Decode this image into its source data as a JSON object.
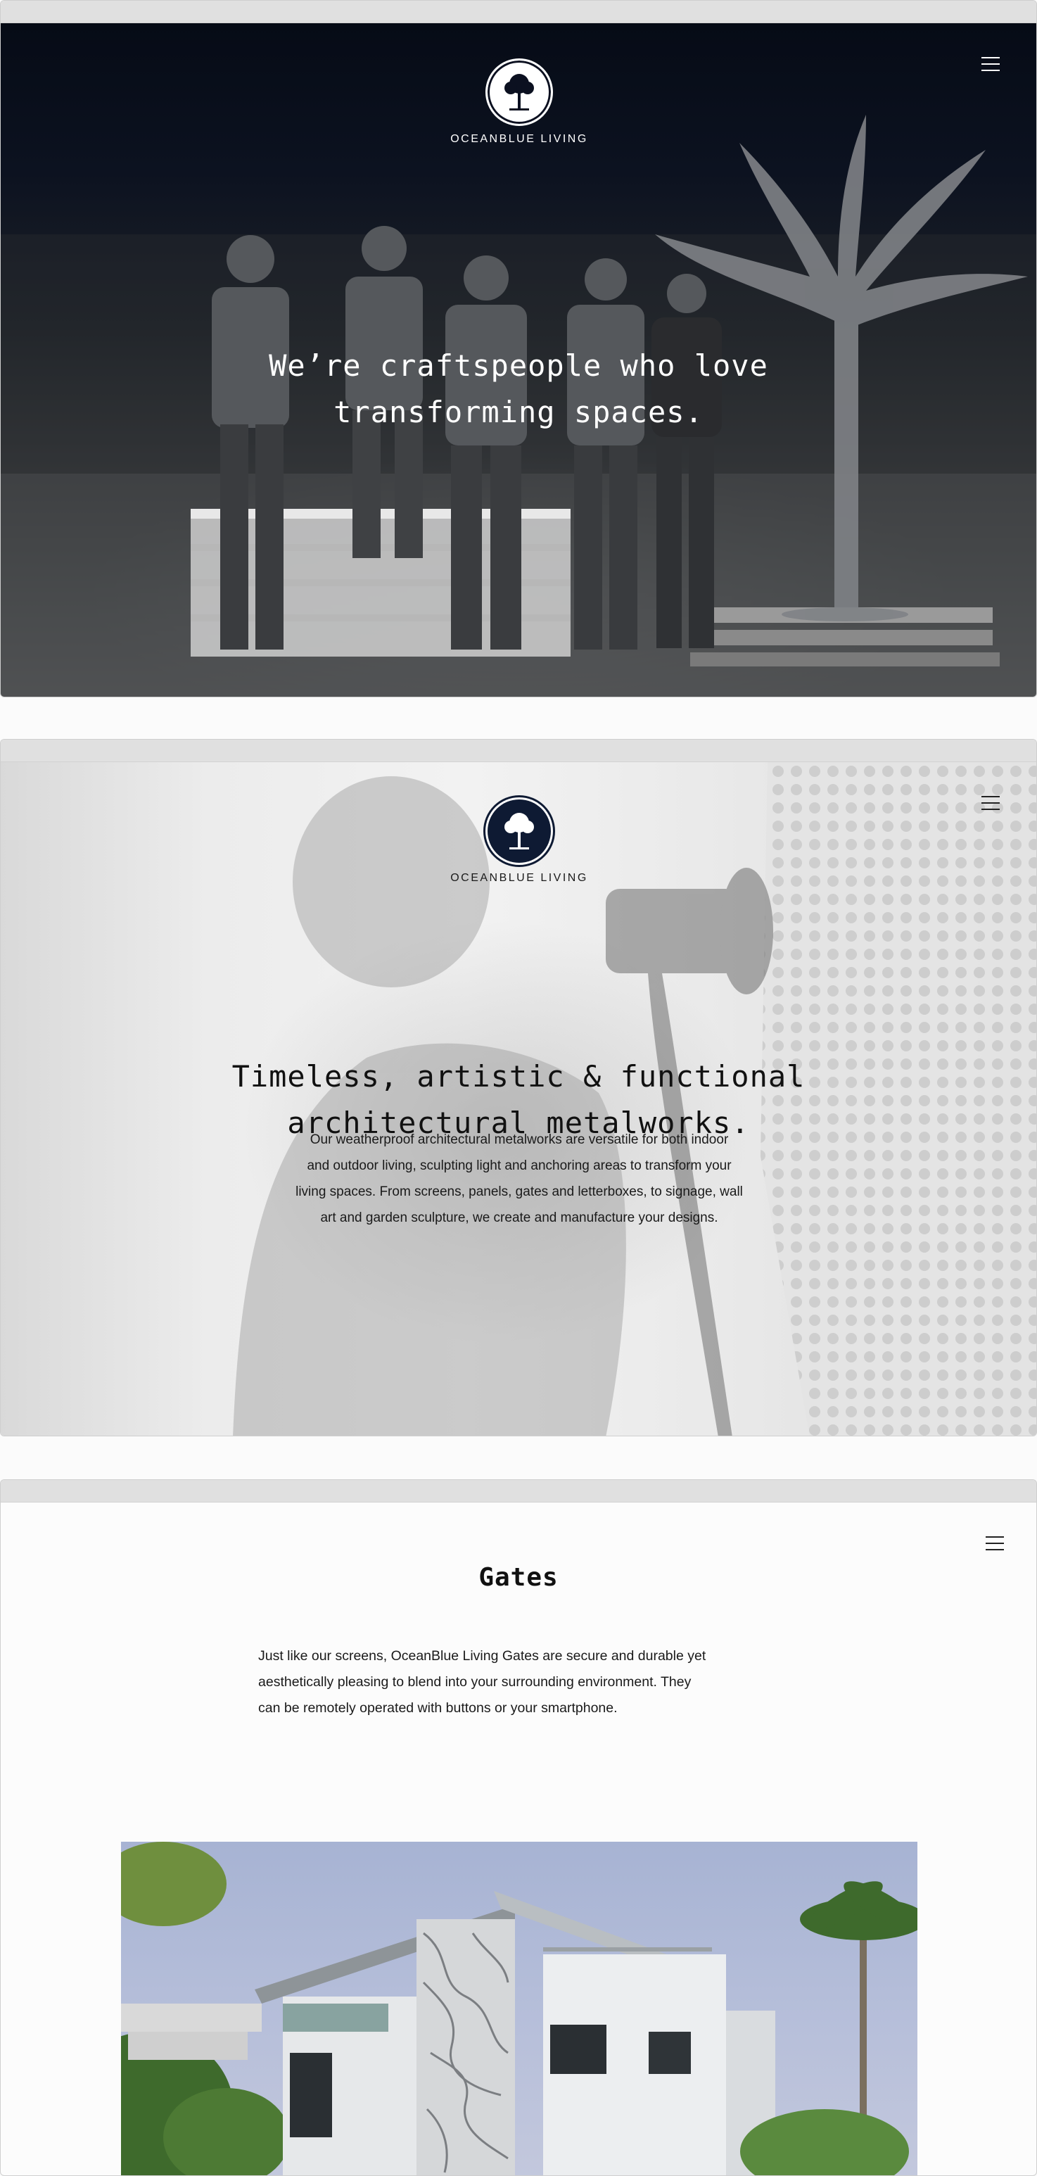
{
  "brand": {
    "name": "OCEANBLUE LIVING",
    "logo_icon": "tree-icon"
  },
  "menu": {
    "icon": "hamburger-menu-icon"
  },
  "screens": [
    {
      "heading_line1": "We’re craftspeople who love",
      "heading_line2": "transforming spaces."
    },
    {
      "heading_line1": "Timeless, artistic & functional",
      "heading_line2": "architectural metalworks.",
      "paragraph_lines": [
        "Our weatherproof architectural metalworks are versatile for both indoor",
        "and outdoor living, sculpting light and anchoring areas to transform your",
        "living spaces. From screens, panels, gates and letterboxes, to signage, wall",
        "art and garden sculpture, we create and manufacture your designs."
      ]
    },
    {
      "title": "Gates",
      "paragraph_lines": [
        "Just like our screens, OceanBlue Living Gates are secure and durable yet",
        "aesthetically pleasing to blend into your surrounding environment. They",
        "can be remotely operated with buttons or your smartphone."
      ]
    }
  ],
  "colors": {
    "navy": "#0e1a33",
    "dark_hero": "#0c1220",
    "page_bg": "#fcfcfc",
    "chrome": "#e0e0e0"
  }
}
